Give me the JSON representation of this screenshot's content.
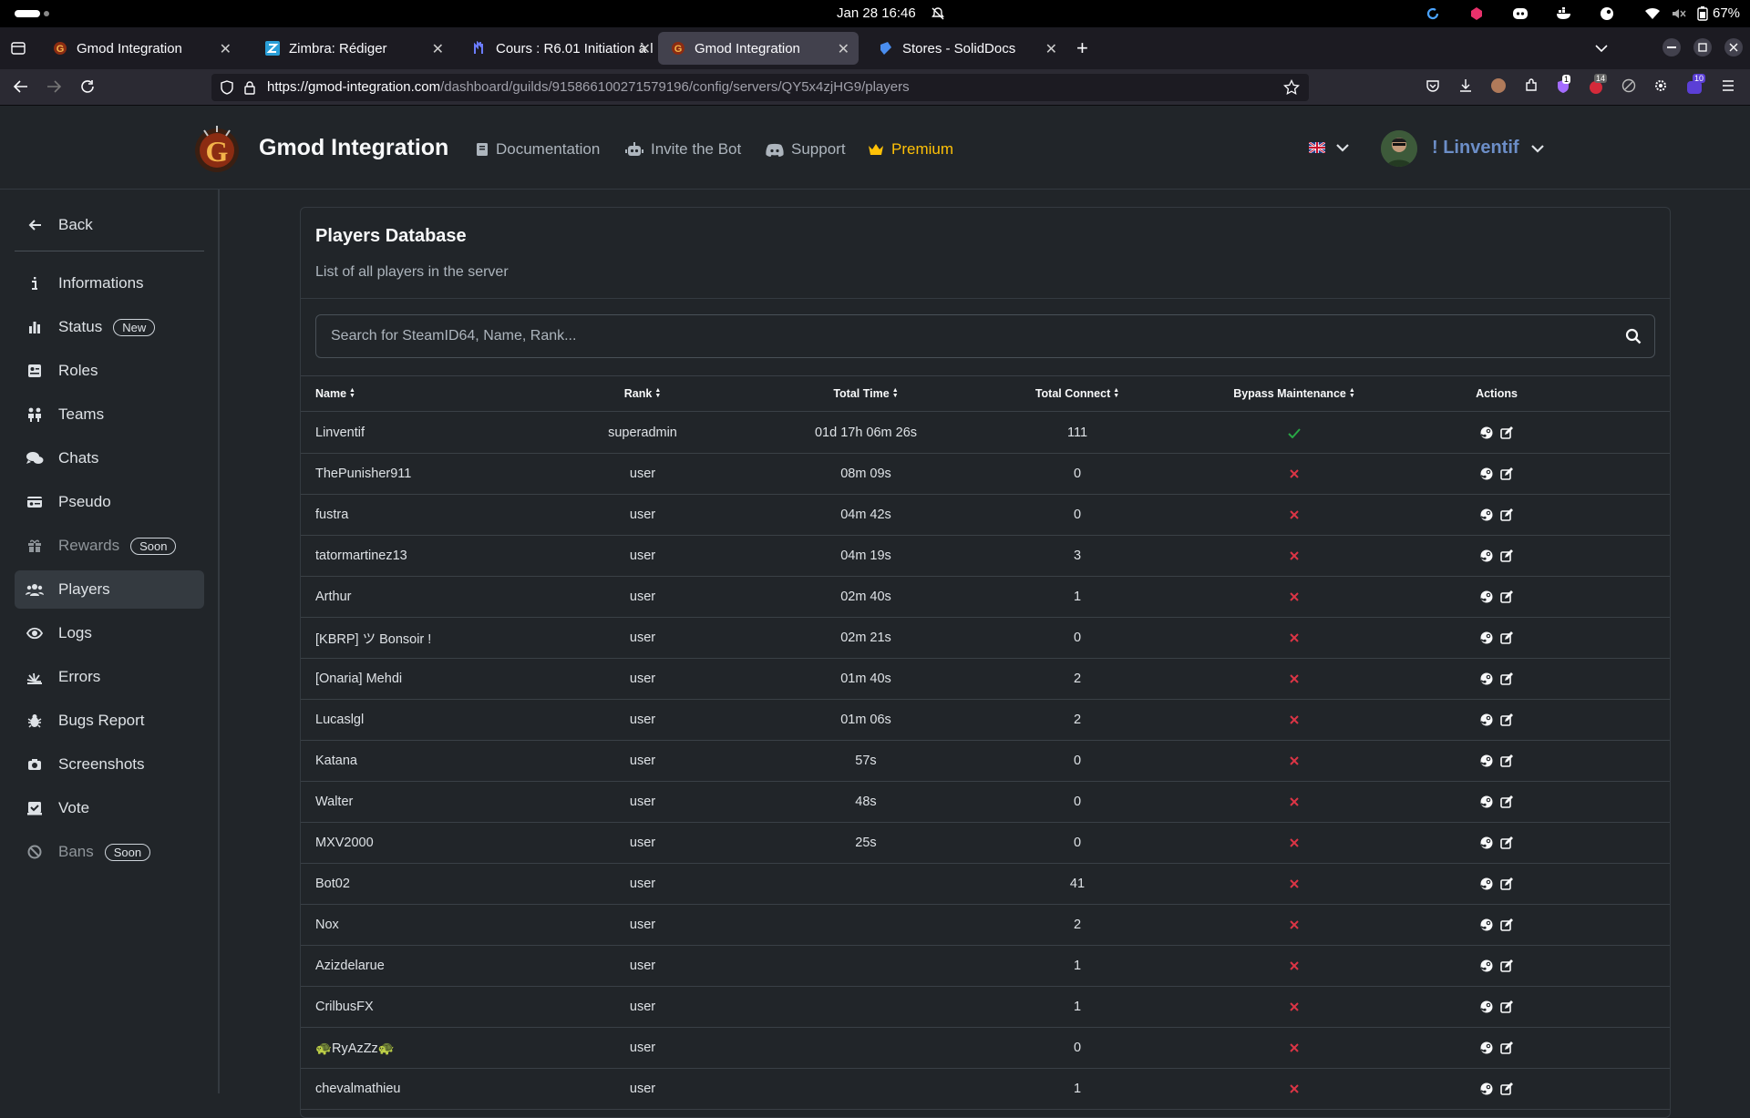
{
  "system": {
    "clock": "Jan 28  16:46",
    "battery": "67%"
  },
  "browser": {
    "tabs": [
      {
        "title": "Gmod Integration",
        "icon": "gmod-icon",
        "active": false
      },
      {
        "title": "Zimbra: Rédiger",
        "icon": "zimbra-icon",
        "active": false
      },
      {
        "title": "Cours : R6.01 Initiation à l",
        "icon": "moodle-icon",
        "active": false
      },
      {
        "title": "Gmod Integration",
        "icon": "gmod-icon",
        "active": true
      },
      {
        "title": "Stores - SolidDocs",
        "icon": "soliddocs-icon",
        "active": false
      }
    ],
    "url_host": "https://gmod-integration.com",
    "url_path": "/dashboard/guilds/915866100271579196/config/servers/QY5x4zjHG9/players",
    "ext_badges": {
      "a": "1",
      "b": "14",
      "c": "10"
    }
  },
  "header": {
    "brand": "Gmod Integration",
    "nav": {
      "docs": "Documentation",
      "invite": "Invite the Bot",
      "support": "Support",
      "premium": "Premium"
    },
    "username": "! Linventif"
  },
  "sidebar": {
    "back": "Back",
    "items": [
      {
        "label": "Informations",
        "icon": "info-icon"
      },
      {
        "label": "Status",
        "icon": "bar-chart-icon",
        "badge": "New"
      },
      {
        "label": "Roles",
        "icon": "id-card-icon"
      },
      {
        "label": "Teams",
        "icon": "people-icon"
      },
      {
        "label": "Chats",
        "icon": "chat-icon"
      },
      {
        "label": "Pseudo",
        "icon": "name-card-icon"
      },
      {
        "label": "Rewards",
        "icon": "gift-icon",
        "badge": "Soon"
      },
      {
        "label": "Players",
        "icon": "users-icon"
      },
      {
        "label": "Logs",
        "icon": "eye-icon"
      },
      {
        "label": "Errors",
        "icon": "explosion-icon"
      },
      {
        "label": "Bugs Report",
        "icon": "bug-icon"
      },
      {
        "label": "Screenshots",
        "icon": "camera-icon"
      },
      {
        "label": "Vote",
        "icon": "vote-icon"
      },
      {
        "label": "Bans",
        "icon": "ban-icon",
        "badge": "Soon"
      }
    ]
  },
  "card": {
    "title": "Players Database",
    "subtitle": "List of all players in the server",
    "search_placeholder": "Search for SteamID64, Name, Rank..."
  },
  "table": {
    "columns": [
      "Name",
      "Rank",
      "Total Time",
      "Total Connect",
      "Bypass Maintenance",
      "Actions"
    ],
    "rows": [
      {
        "name": "Linventif",
        "rank": "superadmin",
        "time": "01d 17h 06m 26s",
        "connect": "111",
        "bypass": true
      },
      {
        "name": "ThePunisher911",
        "rank": "user",
        "time": "08m 09s",
        "connect": "0",
        "bypass": false
      },
      {
        "name": "fustra",
        "rank": "user",
        "time": "04m 42s",
        "connect": "0",
        "bypass": false
      },
      {
        "name": "tatormartinez13",
        "rank": "user",
        "time": "04m 19s",
        "connect": "3",
        "bypass": false
      },
      {
        "name": "Arthur",
        "rank": "user",
        "time": "02m 40s",
        "connect": "1",
        "bypass": false
      },
      {
        "name": "[KBRP] ツ Bonsoir !",
        "rank": "user",
        "time": "02m 21s",
        "connect": "0",
        "bypass": false
      },
      {
        "name": "[Onaria] Mehdi",
        "rank": "user",
        "time": "01m 40s",
        "connect": "2",
        "bypass": false
      },
      {
        "name": "Lucaslgl",
        "rank": "user",
        "time": "01m 06s",
        "connect": "2",
        "bypass": false
      },
      {
        "name": "Katana",
        "rank": "user",
        "time": "57s",
        "connect": "0",
        "bypass": false
      },
      {
        "name": "Walter",
        "rank": "user",
        "time": "48s",
        "connect": "0",
        "bypass": false
      },
      {
        "name": "MXV2000",
        "rank": "user",
        "time": "25s",
        "connect": "0",
        "bypass": false
      },
      {
        "name": "Bot02",
        "rank": "user",
        "time": "",
        "connect": "41",
        "bypass": false
      },
      {
        "name": "Nox",
        "rank": "user",
        "time": "",
        "connect": "2",
        "bypass": false
      },
      {
        "name": "Azizdelarue",
        "rank": "user",
        "time": "",
        "connect": "1",
        "bypass": false
      },
      {
        "name": "CrilbusFX",
        "rank": "user",
        "time": "",
        "connect": "1",
        "bypass": false
      },
      {
        "name": "🐢RyAzZz🐢",
        "rank": "user",
        "time": "",
        "connect": "0",
        "bypass": false
      },
      {
        "name": "chevalmathieu",
        "rank": "user",
        "time": "",
        "connect": "1",
        "bypass": false
      }
    ]
  },
  "colors": {
    "accent": "#ffc107",
    "check": "#28a745",
    "cross": "#dc3545",
    "username": "#6c8ec7"
  }
}
